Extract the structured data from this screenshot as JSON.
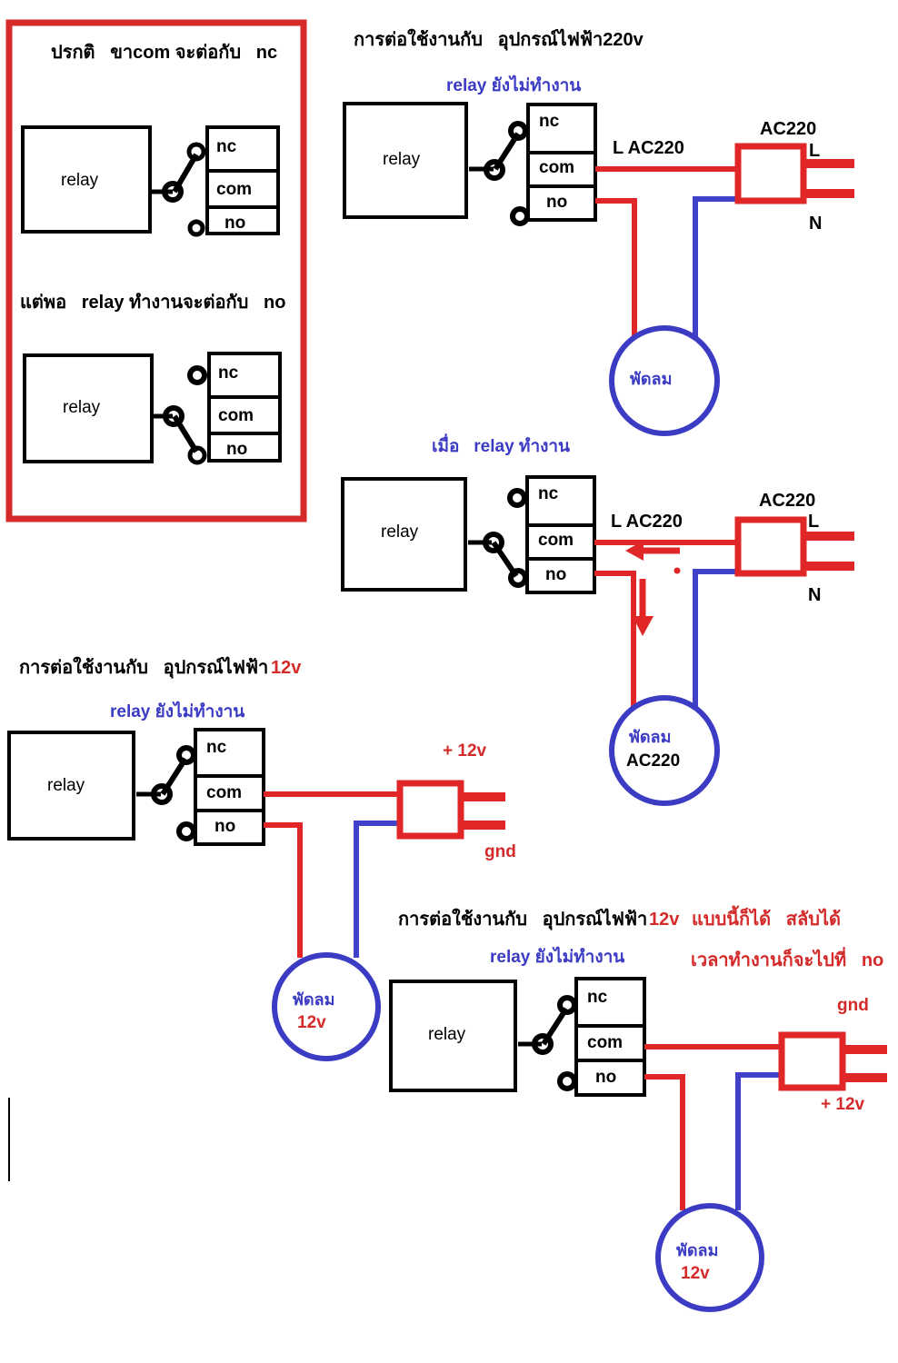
{
  "figure": {
    "title": "Relay wiring diagram (Thai) - relay contact operation with AC220 and 12v devices",
    "colors": {
      "red": "#d42a2a",
      "blue": "#3b3bc4",
      "wire_red": "#e02626",
      "wire_blue": "#4040c8",
      "black": "#000000"
    }
  },
  "panel_red_box": {
    "caption_top": "ปรกติ   ขาcom จะต่อกับ   nc",
    "caption_bottom": "แต่พอ   relay ทำงานจะต่อกับ   no",
    "diagram_top": {
      "relay_label": "relay",
      "terminals": [
        "nc",
        "com",
        "no"
      ],
      "contact_position": "nc"
    },
    "diagram_bottom": {
      "relay_label": "relay",
      "terminals": [
        "nc",
        "com",
        "no"
      ],
      "contact_position": "no"
    }
  },
  "panel_ac220": {
    "heading": "การต่อใช้งานกับ   อุปกรณ์ไฟฟ้า220v",
    "state_1": {
      "state_label": "relay ยังไม่ทำงาน",
      "relay_label": "relay",
      "terminals": [
        "nc",
        "com",
        "no"
      ],
      "contact_position": "nc",
      "wire_label": "L AC220",
      "source_label": "AC220",
      "pin_l": "L",
      "pin_n": "N",
      "load_label": "พัดลม"
    },
    "state_2": {
      "state_label": "เมื่อ   relay ทำงาน",
      "relay_label": "relay",
      "terminals": [
        "nc",
        "com",
        "no"
      ],
      "contact_position": "no",
      "wire_label": "L AC220",
      "source_label": "AC220",
      "pin_l": "L",
      "pin_n": "N",
      "load_label_line1": "พัดลม",
      "load_label_line2": "AC220",
      "flow_arrows": [
        "left",
        "down"
      ]
    }
  },
  "panel_12v_left": {
    "heading_black": "การต่อใช้งานกับ   อุปกรณ์ไฟฟ้า",
    "heading_red": "12v",
    "state_label": "relay ยังไม่ทำงาน",
    "relay_label": "relay",
    "terminals": [
      "nc",
      "com",
      "no"
    ],
    "contact_position": "nc",
    "supply_plus": "+ 12v",
    "supply_gnd": "gnd",
    "load_label_line1": "พัดลม",
    "load_label_line2": "12v"
  },
  "panel_12v_right": {
    "heading_black": "การต่อใช้งานกับ   อุปกรณ์ไฟฟ้า",
    "heading_red": "12v",
    "note_line1": "แบบนี้ก็ได้   สลับได้",
    "note_line2": "เวลาทำงานก็จะไปที่   no",
    "state_label": "relay ยังไม่ทำงาน",
    "relay_label": "relay",
    "terminals": [
      "nc",
      "com",
      "no"
    ],
    "contact_position": "nc",
    "supply_gnd": "gnd",
    "supply_plus": "+ 12v",
    "load_label_line1": "พัดลม",
    "load_label_line2": "12v"
  }
}
